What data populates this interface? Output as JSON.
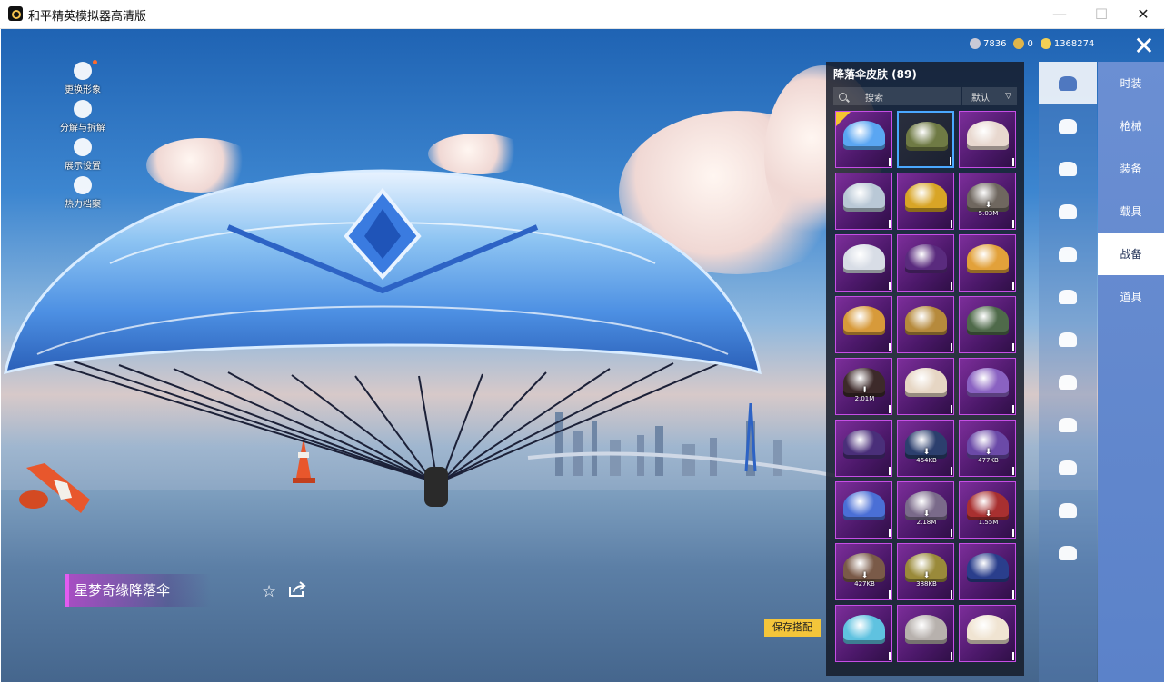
{
  "window": {
    "title": "和平精英模拟器高清版",
    "minimize": "—",
    "maximize": "☐",
    "close": "✕"
  },
  "left_menu": [
    {
      "label": "更换形象",
      "icon": "avatar-icon",
      "has_dot": true
    },
    {
      "label": "分解与拆解",
      "icon": "puzzle-icon",
      "has_dot": false
    },
    {
      "label": "展示设置",
      "icon": "eye-icon",
      "has_dot": false
    },
    {
      "label": "热力档案",
      "icon": "flame-icon",
      "has_dot": false
    }
  ],
  "currency": [
    {
      "value": "7836",
      "icon": "premium-coin-icon"
    },
    {
      "value": "0",
      "icon": "token-icon"
    },
    {
      "value": "1368274",
      "icon": "gold-coin-icon"
    }
  ],
  "close_label": "✕",
  "panel": {
    "title": "降落伞皮肤 (89)",
    "search_placeholder": "搜索",
    "sort_label": "默认"
  },
  "skins": [
    {
      "color": "#5aa6f2",
      "dl": "",
      "bg": "purple",
      "checked": true
    },
    {
      "color": "#6f7a44",
      "dl": "",
      "bg": "dark",
      "selected": true
    },
    {
      "color": "#e8d8cf",
      "dl": "",
      "bg": "purple"
    },
    {
      "color": "#b9c8d6",
      "dl": "",
      "bg": "purple"
    },
    {
      "color": "#d8a526",
      "dl": "",
      "bg": "purple"
    },
    {
      "color": "#6f675f",
      "dl": "5.03M",
      "bg": "purple"
    },
    {
      "color": "#d8dde6",
      "dl": "",
      "bg": "purple"
    },
    {
      "color": "#5a2b7e",
      "dl": "",
      "bg": "purple"
    },
    {
      "color": "#e2a13a",
      "dl": "",
      "bg": "purple"
    },
    {
      "color": "#d79a3a",
      "dl": "",
      "bg": "purple"
    },
    {
      "color": "#b68a3c",
      "dl": "",
      "bg": "purple"
    },
    {
      "color": "#4f6a4a",
      "dl": "",
      "bg": "purple"
    },
    {
      "color": "#3d2a2a",
      "dl": "2.01M",
      "bg": "purple"
    },
    {
      "color": "#e6d6c4",
      "dl": "",
      "bg": "purple"
    },
    {
      "color": "#8a62c2",
      "dl": "",
      "bg": "purple"
    },
    {
      "color": "#4a2f7a",
      "dl": "",
      "bg": "purple"
    },
    {
      "color": "#2c3f6e",
      "dl": "464KB",
      "bg": "purple"
    },
    {
      "color": "#6b4aa8",
      "dl": "477KB",
      "bg": "purple"
    },
    {
      "color": "#4a6fd6",
      "dl": "",
      "bg": "purple"
    },
    {
      "color": "#7a6a8a",
      "dl": "2.18M",
      "bg": "purple"
    },
    {
      "color": "#a83030",
      "dl": "1.55M",
      "bg": "purple"
    },
    {
      "color": "#7a5a48",
      "dl": "427KB",
      "bg": "purple"
    },
    {
      "color": "#9a8a3a",
      "dl": "388KB",
      "bg": "purple"
    },
    {
      "color": "#2a3e8c",
      "dl": "",
      "bg": "purple"
    },
    {
      "color": "#5fc2e0",
      "dl": "",
      "bg": "purple"
    },
    {
      "color": "#b7b1ad",
      "dl": "",
      "bg": "purple"
    },
    {
      "color": "#f0e4d2",
      "dl": "",
      "bg": "purple"
    }
  ],
  "nav_icons": [
    {
      "name": "parachute-icon",
      "active": true
    },
    {
      "name": "vehicle-icon"
    },
    {
      "name": "plane-icon"
    },
    {
      "name": "emote-icon"
    },
    {
      "name": "robot-icon"
    },
    {
      "name": "speaker-icon"
    },
    {
      "name": "chat-icon"
    },
    {
      "name": "picture-icon"
    },
    {
      "name": "extinguisher-icon"
    },
    {
      "name": "gesture-icon"
    },
    {
      "name": "sparkle-icon"
    },
    {
      "name": "pet-icon"
    }
  ],
  "tabs": [
    {
      "label": "时装"
    },
    {
      "label": "枪械"
    },
    {
      "label": "装备"
    },
    {
      "label": "载具"
    },
    {
      "label": "战备",
      "active": true
    },
    {
      "label": "道具"
    }
  ],
  "skin_name": "星梦奇缘降落伞",
  "save_label": "保存搭配",
  "colors": {
    "accent": "#f4c53a",
    "purple_frame": "#c64ee6",
    "tab_bg": "#6b8fd3"
  }
}
